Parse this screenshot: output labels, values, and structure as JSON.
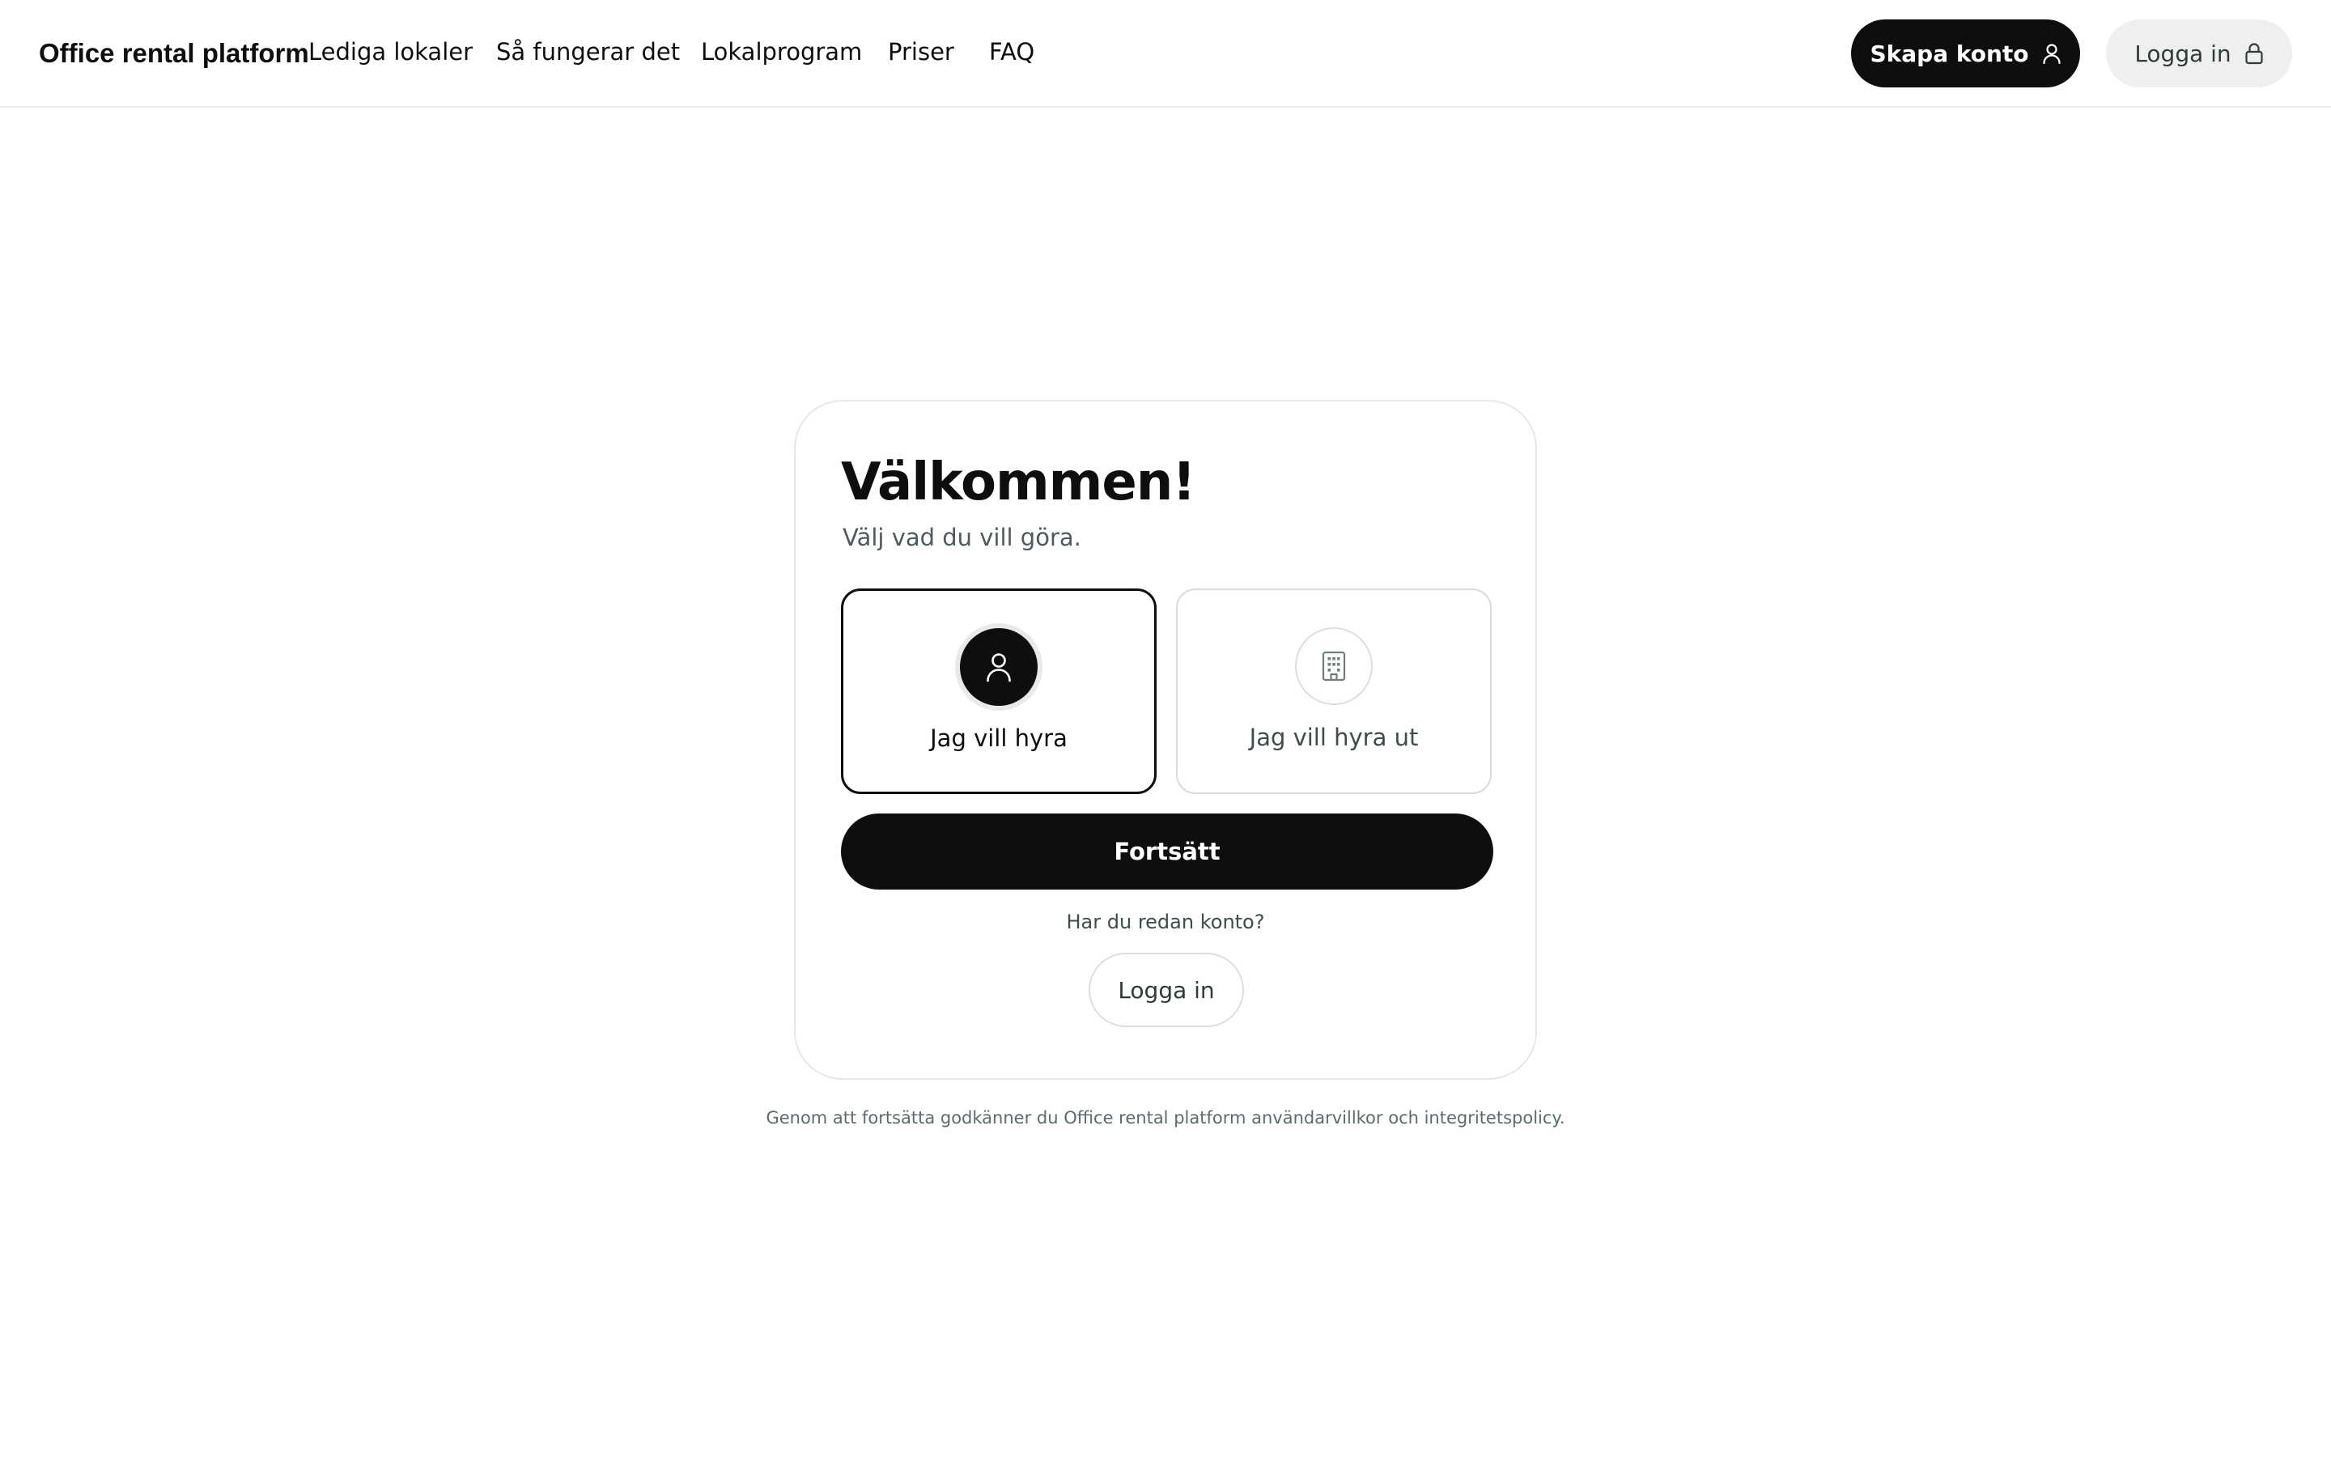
{
  "header": {
    "brand": "Office rental platform",
    "nav": [
      {
        "label": "Lediga lokaler"
      },
      {
        "label": "Så fungerar det"
      },
      {
        "label": "Lokalprogram"
      },
      {
        "label": "Priser"
      },
      {
        "label": "FAQ"
      }
    ],
    "signup_label": "Skapa konto",
    "signup_icon": "user-icon",
    "login_label": "Logga in",
    "login_icon": "lock-icon"
  },
  "card": {
    "title": "Välkommen!",
    "subtitle": "Välj vad du vill göra.",
    "options": [
      {
        "label": "Jag vill hyra",
        "icon": "user-icon",
        "selected": true
      },
      {
        "label": "Jag vill hyra ut",
        "icon": "building-icon",
        "selected": false
      }
    ],
    "continue_label": "Fortsätt",
    "has_account_text": "Har du redan konto?",
    "login_label": "Logga in"
  },
  "legal_text": "Genom att fortsätta godkänner du Office rental platform användarvillkor och integritetspolicy.",
  "colors": {
    "primary": "#0d0e10",
    "muted_text": "#4d5b5c",
    "border": "#e5e7ea",
    "secondary_button_bg": "#efefef"
  }
}
